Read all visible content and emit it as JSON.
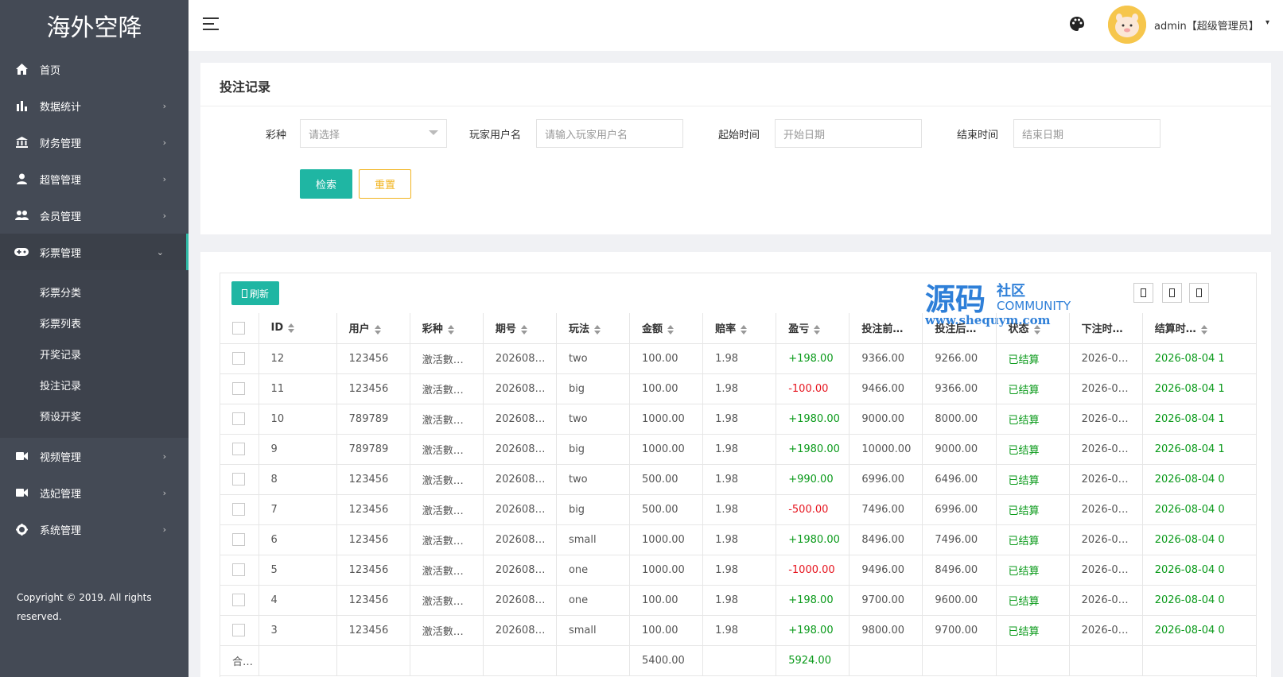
{
  "app": {
    "logo": "海外空降"
  },
  "sidebar": {
    "items": [
      {
        "label": "首页",
        "icon": "home-icon",
        "arrow": ""
      },
      {
        "label": "数据统计",
        "icon": "bar-chart-icon",
        "arrow": "›"
      },
      {
        "label": "财务管理",
        "icon": "bank-icon",
        "arrow": "›"
      },
      {
        "label": "超管管理",
        "icon": "user-icon",
        "arrow": "›"
      },
      {
        "label": "会员管理",
        "icon": "users-icon",
        "arrow": "›"
      },
      {
        "label": "彩票管理",
        "icon": "gamepad-icon",
        "arrow": "⌄"
      }
    ],
    "submenu": [
      "彩票分类",
      "彩票列表",
      "开奖记录",
      "投注记录",
      "预设开奖"
    ],
    "items_after": [
      {
        "label": "视频管理",
        "icon": "video-icon",
        "arrow": "›"
      },
      {
        "label": "选妃管理",
        "icon": "video-icon",
        "arrow": "›"
      },
      {
        "label": "系统管理",
        "icon": "gear-icon",
        "arrow": "›"
      }
    ],
    "copyright": "Copyright © 2019. All rights reserved."
  },
  "header": {
    "user": "admin【超级管理员】",
    "caret": "▾"
  },
  "search": {
    "title": "投注记录",
    "lottery_label": "彩种",
    "lottery_placeholder": "请选择",
    "player_label": "玩家用户名",
    "player_placeholder": "请输入玩家用户名",
    "start_label": "起始时间",
    "start_placeholder": "开始日期",
    "end_label": "结束时间",
    "end_placeholder": "结束日期",
    "search_button": "检索",
    "reset_button": "重置"
  },
  "table": {
    "refresh_button": "刷新",
    "watermark": {
      "main": "源码",
      "side": "社区",
      "community": "COMMUNITY",
      "url": "www.shequym.com"
    },
    "headers": [
      "ID",
      "用户",
      "彩种",
      "期号",
      "玩法",
      "金额",
      "赔率",
      "盈亏",
      "投注前…",
      "投注后…",
      "状态",
      "下注时…",
      "结算时…"
    ],
    "rows": [
      [
        "12",
        "123456",
        "激活數…",
        "202608…",
        "two",
        "100.00",
        "1.98",
        "+198.00",
        "9366.00",
        "9266.00",
        "已结算",
        "2026-0…",
        "2026-08-04 1"
      ],
      [
        "11",
        "123456",
        "激活數…",
        "202608…",
        "big",
        "100.00",
        "1.98",
        "-100.00",
        "9466.00",
        "9366.00",
        "已结算",
        "2026-0…",
        "2026-08-04 1"
      ],
      [
        "10",
        "789789",
        "激活數…",
        "202608…",
        "two",
        "1000.00",
        "1.98",
        "+1980.00",
        "9000.00",
        "8000.00",
        "已结算",
        "2026-0…",
        "2026-08-04 1"
      ],
      [
        "9",
        "789789",
        "激活數…",
        "202608…",
        "big",
        "1000.00",
        "1.98",
        "+1980.00",
        "10000.00",
        "9000.00",
        "已结算",
        "2026-0…",
        "2026-08-04 1"
      ],
      [
        "8",
        "123456",
        "激活數…",
        "202608…",
        "two",
        "500.00",
        "1.98",
        "+990.00",
        "6996.00",
        "6496.00",
        "已结算",
        "2026-0…",
        "2026-08-04 0"
      ],
      [
        "7",
        "123456",
        "激活數…",
        "202608…",
        "big",
        "500.00",
        "1.98",
        "-500.00",
        "7496.00",
        "6996.00",
        "已结算",
        "2026-0…",
        "2026-08-04 0"
      ],
      [
        "6",
        "123456",
        "激活數…",
        "202608…",
        "small",
        "1000.00",
        "1.98",
        "+1980.00",
        "8496.00",
        "7496.00",
        "已结算",
        "2026-0…",
        "2026-08-04 0"
      ],
      [
        "5",
        "123456",
        "激活數…",
        "202608…",
        "one",
        "1000.00",
        "1.98",
        "-1000.00",
        "9496.00",
        "8496.00",
        "已结算",
        "2026-0…",
        "2026-08-04 0"
      ],
      [
        "4",
        "123456",
        "激活數…",
        "202608…",
        "one",
        "100.00",
        "1.98",
        "+198.00",
        "9700.00",
        "9600.00",
        "已结算",
        "2026-0…",
        "2026-08-04 0"
      ],
      [
        "3",
        "123456",
        "激活數…",
        "202608…",
        "small",
        "100.00",
        "1.98",
        "+198.00",
        "9800.00",
        "9700.00",
        "已结算",
        "2026-0…",
        "2026-08-04 0"
      ]
    ],
    "total": {
      "label": "合…",
      "amount": "5400.00",
      "profit": "5924.00"
    }
  }
}
